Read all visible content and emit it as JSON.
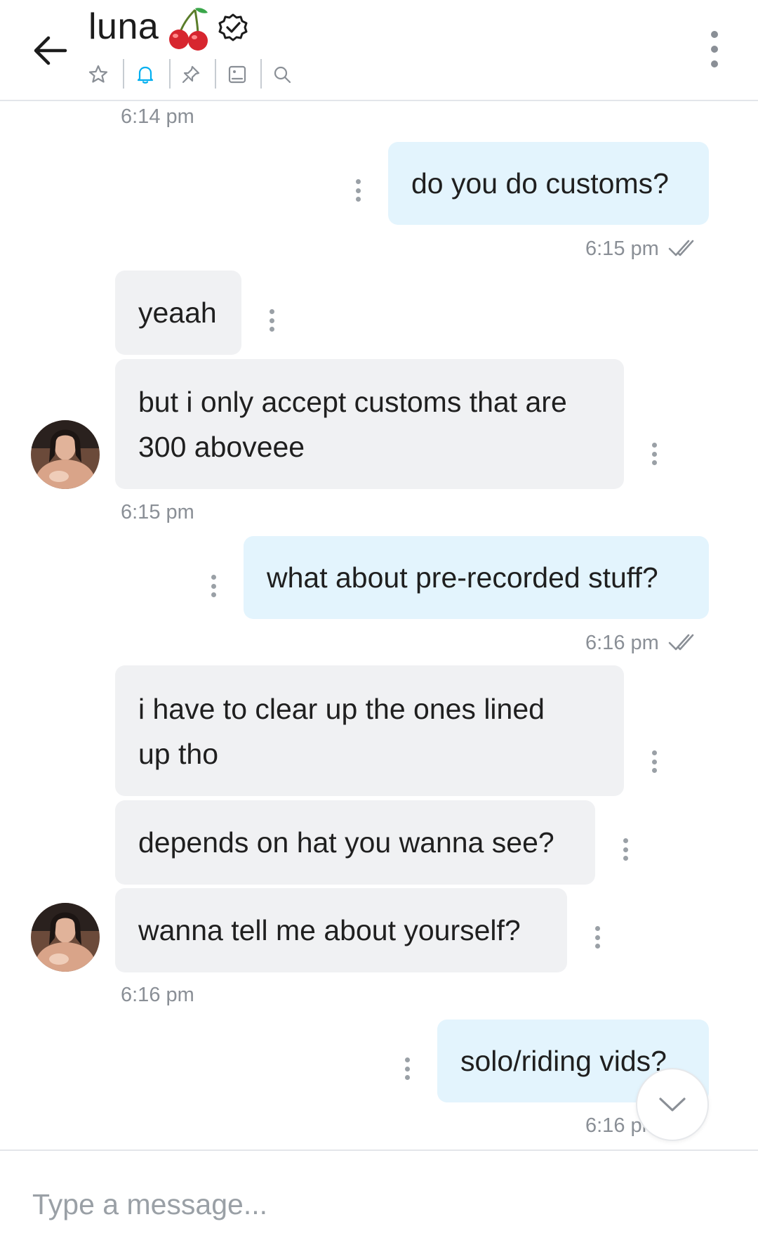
{
  "header": {
    "title": "luna",
    "title_emoji": "cherries",
    "verified_icon": "verified-badge-icon",
    "tools": [
      "star-icon",
      "bell-icon",
      "pin-icon",
      "image-icon",
      "search-icon"
    ]
  },
  "messages": [
    {
      "id": "m0",
      "time": "6:14 pm"
    },
    {
      "id": "m1",
      "dir": "out",
      "text": "do you do customs?",
      "time": "6:15 pm",
      "status": "read"
    },
    {
      "id": "m2",
      "dir": "in",
      "text": "yeaah"
    },
    {
      "id": "m3",
      "dir": "in",
      "lines": [
        "but i only accept customs that are",
        "300 aboveee"
      ],
      "time": "6:15 pm"
    },
    {
      "id": "m4",
      "dir": "out",
      "text": "what about pre-recorded stuff?",
      "time": "6:16 pm",
      "status": "read"
    },
    {
      "id": "m5",
      "dir": "in",
      "lines": [
        "i have to clear up the ones lined",
        "up tho"
      ]
    },
    {
      "id": "m6",
      "dir": "in",
      "text": "depends on hat you wanna see?"
    },
    {
      "id": "m7",
      "dir": "in",
      "text": "wanna tell me about yourself?",
      "time": "6:16 pm"
    },
    {
      "id": "m8",
      "dir": "out",
      "text": "solo/riding vids?",
      "time": "6:16 pm"
    }
  ],
  "composer": {
    "placeholder": "Type a message..."
  },
  "colors": {
    "incoming_bubble": "#f0f1f3",
    "outgoing_bubble": "#e3f4fd",
    "accent": "#00aff0",
    "muted": "#8a8f96"
  }
}
